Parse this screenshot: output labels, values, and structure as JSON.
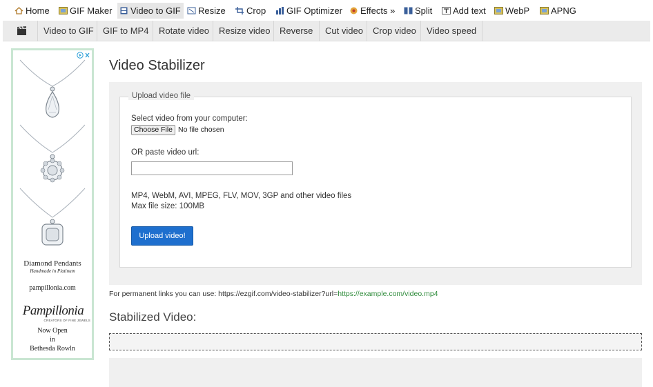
{
  "topnav": [
    {
      "label": "Home",
      "icon": "home-icon"
    },
    {
      "label": "GIF Maker",
      "icon": "gif-maker-icon"
    },
    {
      "label": "Video to GIF",
      "icon": "video-icon",
      "active": true
    },
    {
      "label": "Resize",
      "icon": "resize-icon"
    },
    {
      "label": "Crop",
      "icon": "crop-icon"
    },
    {
      "label": "GIF Optimizer",
      "icon": "optimizer-icon"
    },
    {
      "label": "Effects »",
      "icon": "effects-icon"
    },
    {
      "label": "Split",
      "icon": "split-icon"
    },
    {
      "label": "Add text",
      "icon": "text-icon"
    },
    {
      "label": "WebP",
      "icon": "webp-icon"
    },
    {
      "label": "APNG",
      "icon": "apng-icon"
    }
  ],
  "subnav": [
    "Video to GIF",
    "GIF to MP4",
    "Rotate video",
    "Resize video",
    "Reverse",
    "Cut video",
    "Crop video",
    "Video speed"
  ],
  "ad": {
    "title": "Diamond Pendants",
    "subtitle": "Handmade in Platinum",
    "site": "pampillonia.com",
    "brand": "Pampillonia",
    "brand_tagline": "CREATORS OF FINE JEWELS",
    "line1": "Now Open",
    "line2": "in",
    "line3": "Bethesda Rowln"
  },
  "page": {
    "title": "Video Stabilizer",
    "legend": "Upload video file",
    "select_label": "Select video from your computer:",
    "choose_file": "Choose File",
    "no_file": "No file chosen",
    "url_label": "OR paste video url:",
    "url_value": "",
    "formats": "MP4, WebM, AVI, MPEG, FLV, MOV, 3GP and other video files",
    "max_size": "Max file size: 100MB",
    "upload_button": "Upload video!",
    "perm_prefix": "For permanent links you can use: https://ezgif.com/video-stabilizer?url=",
    "perm_link": "https://example.com/video.mp4",
    "stabilized_heading": "Stabilized Video:"
  }
}
